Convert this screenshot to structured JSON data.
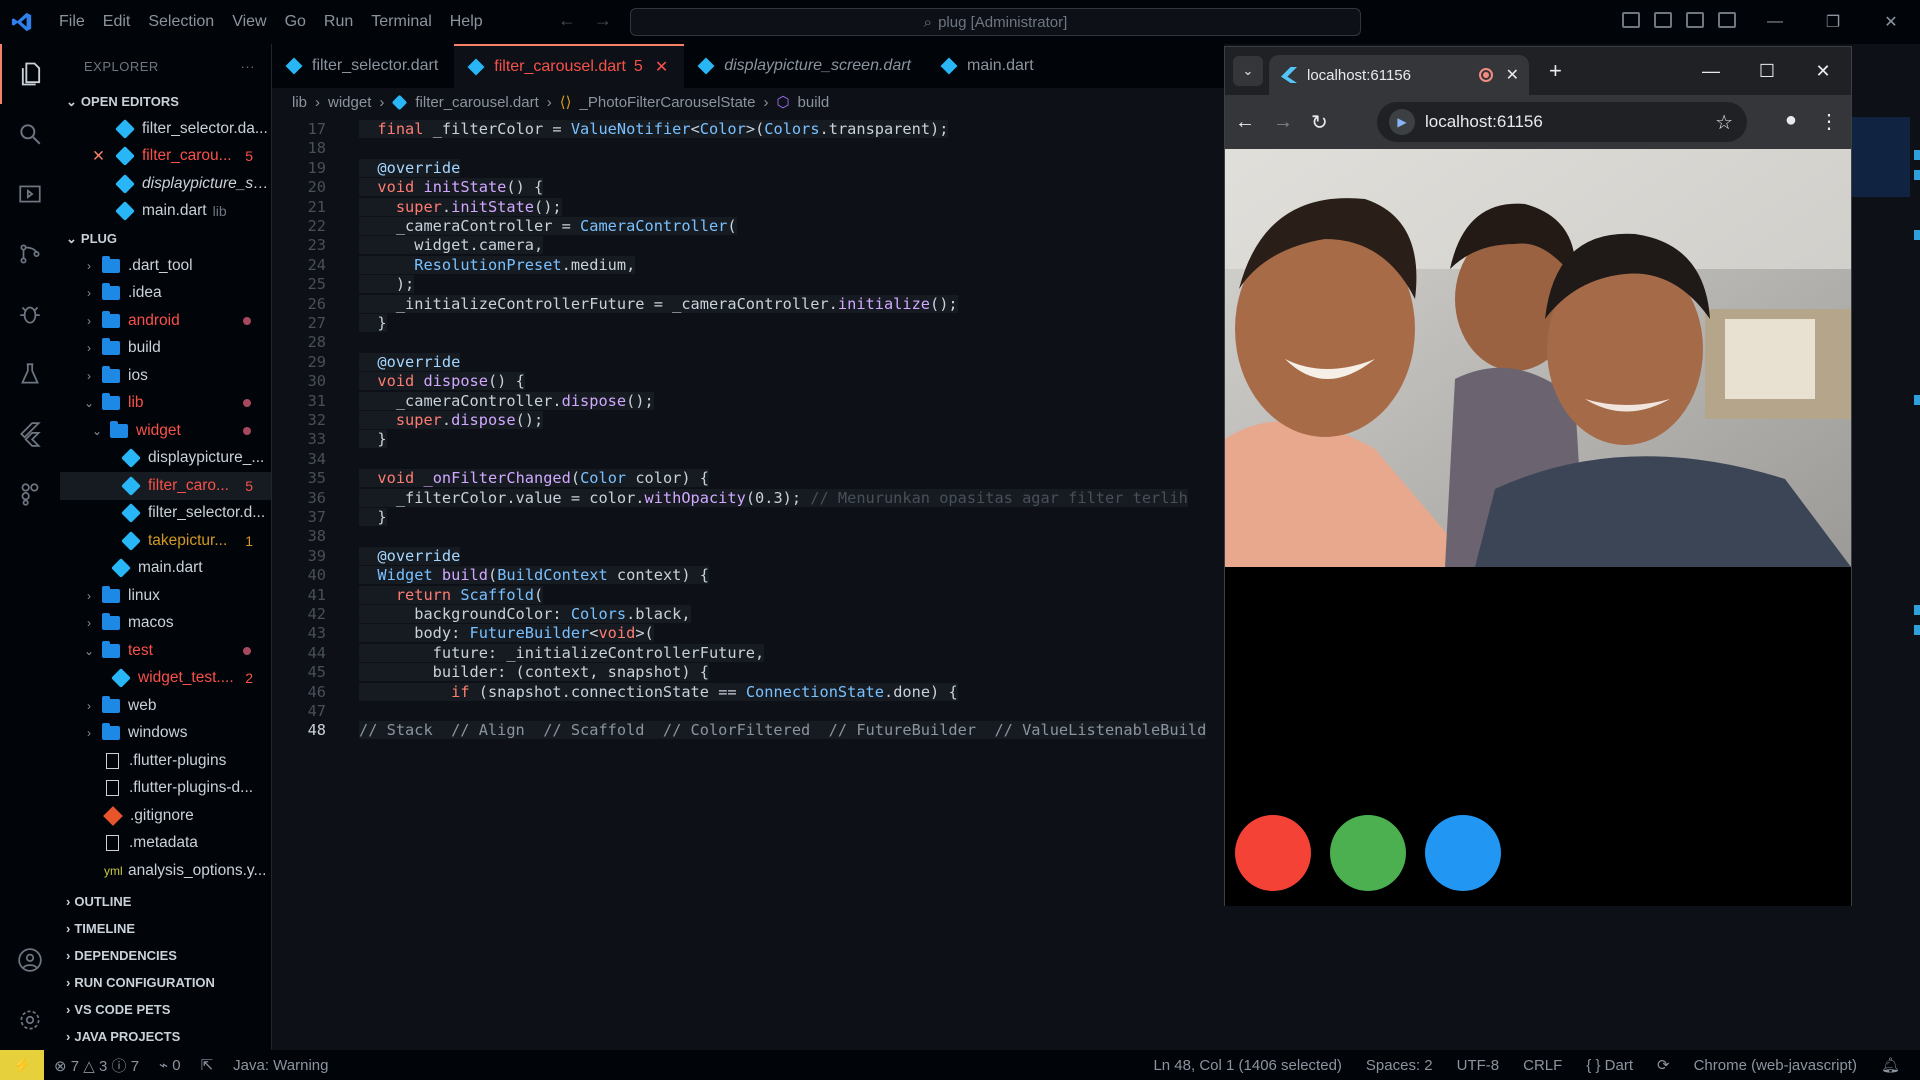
{
  "menu": [
    "File",
    "Edit",
    "Selection",
    "View",
    "Go",
    "Run",
    "Terminal",
    "Help"
  ],
  "search_text": "plug [Administrator]",
  "explorer": {
    "title": "EXPLORER",
    "open_editors_label": "OPEN EDITORS",
    "open_editors": [
      {
        "name": "filter_selector.da...",
        "badge": ""
      },
      {
        "name": "filter_carou...",
        "badge": "5"
      },
      {
        "name": "displaypicture_sc...",
        "badge": ""
      },
      {
        "name": "main.dart",
        "suffix": "lib",
        "badge": ""
      }
    ],
    "project_label": "PLUG",
    "tree": [
      {
        "name": ".dart_tool"
      },
      {
        "name": ".idea"
      },
      {
        "name": "android"
      },
      {
        "name": "build"
      },
      {
        "name": "ios"
      },
      {
        "name": "lib"
      },
      {
        "name": "widget"
      },
      {
        "name": "displaypicture_..."
      },
      {
        "name": "filter_caro...",
        "badge": "5"
      },
      {
        "name": "filter_selector.d..."
      },
      {
        "name": "takepictur...",
        "badge": "1"
      },
      {
        "name": "main.dart"
      },
      {
        "name": "linux"
      },
      {
        "name": "macos"
      },
      {
        "name": "test"
      },
      {
        "name": "widget_test....",
        "badge": "2"
      },
      {
        "name": "web"
      },
      {
        "name": "windows"
      },
      {
        "name": ".flutter-plugins"
      },
      {
        "name": ".flutter-plugins-d..."
      },
      {
        "name": ".gitignore"
      },
      {
        "name": ".metadata"
      },
      {
        "name": "analysis_options.y..."
      }
    ],
    "bottom_sections": [
      "OUTLINE",
      "TIMELINE",
      "DEPENDENCIES",
      "RUN CONFIGURATION",
      "VS CODE PETS",
      "JAVA PROJECTS"
    ]
  },
  "tabs": [
    {
      "label": "filter_selector.dart"
    },
    {
      "label": "filter_carousel.dart",
      "badge": "5"
    },
    {
      "label": "displaypicture_screen.dart"
    },
    {
      "label": "main.dart"
    }
  ],
  "breadcrumb": [
    "lib",
    "widget",
    "filter_carousel.dart",
    "_PhotoFilterCarouselState",
    "build"
  ],
  "editor": {
    "line_numbers": [
      "17",
      "18",
      "19",
      "20",
      "21",
      "22",
      "23",
      "24",
      "25",
      "26",
      "27",
      "28",
      "29",
      "30",
      "31",
      "32",
      "33",
      "34",
      "35",
      "36",
      "37",
      "38",
      "39",
      "40",
      "41",
      "42",
      "43",
      "44",
      "45",
      "46",
      "47",
      "48"
    ],
    "current_line": "48",
    "lines": [
      "  final _filterColor = ValueNotifier<Color>(Colors.transparent);",
      "",
      "  @override",
      "  void initState() {",
      "    super.initState();",
      "    _cameraController = CameraController(",
      "      widget.camera,",
      "      ResolutionPreset.medium,",
      "    );",
      "    _initializeControllerFuture = _cameraController.initialize();",
      "  }",
      "",
      "  @override",
      "  void dispose() {",
      "    _cameraController.dispose();",
      "    super.dispose();",
      "  }",
      "",
      "  void _onFilterChanged(Color color) {",
      "    _filterColor.value = color.withOpacity(0.3); // Menurunkan opasitas agar filter terlih",
      "  }",
      "",
      "  @override",
      "  Widget build(BuildContext context) {",
      "    return Scaffold(",
      "      backgroundColor: Colors.black,",
      "      body: FutureBuilder<void>(",
      "        future: _initializeControllerFuture,",
      "        builder: (context, snapshot) {",
      "          if (snapshot.connectionState == ConnectionState.done) {",
      "",
      "// Stack  // Align  // Scaffold  // ColorFiltered  // FutureBuilder  // ValueListenableBuild"
    ]
  },
  "browser": {
    "tab_title": "localhost:61156",
    "url": "localhost:61156",
    "filter_colors": [
      "#f44336",
      "#4caf50",
      "#2196f3"
    ]
  },
  "status": {
    "errors": "7",
    "warnings": "3",
    "infos": "7",
    "ports": "0",
    "java": "Java: Warning",
    "position": "Ln 48, Col 1 (1406 selected)",
    "spaces": "Spaces: 2",
    "encoding": "UTF-8",
    "eol": "CRLF",
    "language": "Dart",
    "device": "Chrome (web-javascript)"
  }
}
